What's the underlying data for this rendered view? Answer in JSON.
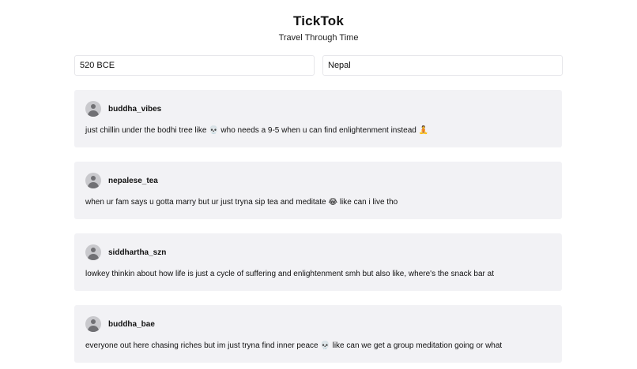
{
  "header": {
    "title": "TickTok",
    "subtitle": "Travel Through Time"
  },
  "inputs": {
    "time_value": "520 BCE",
    "place_value": "Nepal"
  },
  "posts": [
    {
      "username": "buddha_vibes",
      "text": "just chillin under the bodhi tree like 💀 who needs a 9-5 when u can find enlightenment instead 🧘"
    },
    {
      "username": "nepalese_tea",
      "text": "when ur fam says u gotta marry but ur just tryna sip tea and meditate 😂 like can i live tho"
    },
    {
      "username": "siddhartha_szn",
      "text": "lowkey thinkin about how life is just a cycle of suffering and enlightenment smh but also like, where's the snack bar at"
    },
    {
      "username": "buddha_bae",
      "text": "everyone out here chasing riches but im just tryna find inner peace 💀 like can we get a group meditation going or what"
    }
  ],
  "icons": {
    "avatar": "user-avatar-icon"
  }
}
